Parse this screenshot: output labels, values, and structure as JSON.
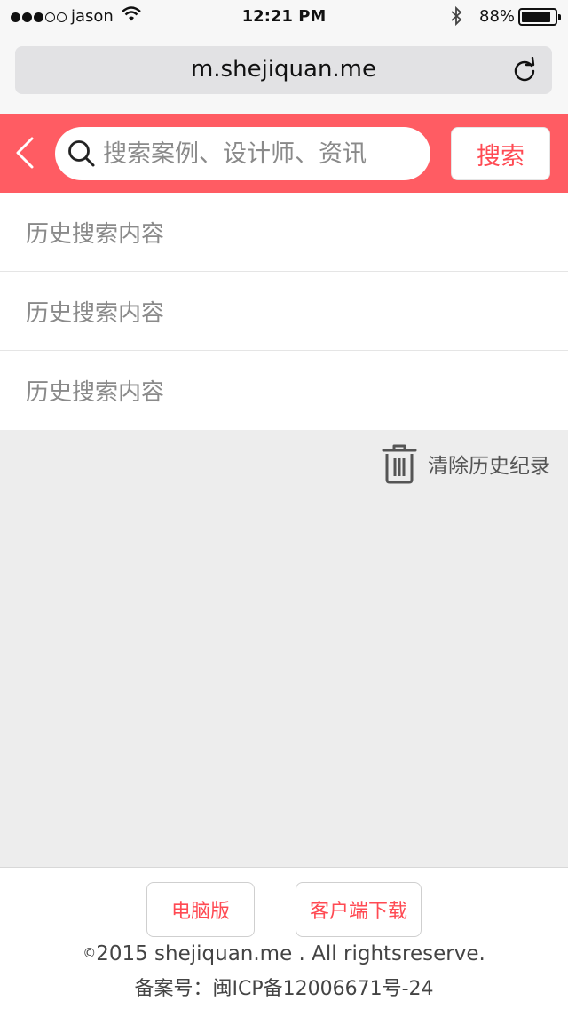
{
  "status_bar": {
    "carrier": "jason",
    "time": "12:21 PM",
    "battery_percent": "88%",
    "battery_level": 0.88,
    "signal_bars_filled": 3,
    "signal_bars_total": 5
  },
  "browser": {
    "url": "m.shejiquan.me"
  },
  "search": {
    "placeholder": "搜索案例、设计师、资讯",
    "button_label": "搜索"
  },
  "history": {
    "items": [
      {
        "label": "历史搜索内容"
      },
      {
        "label": "历史搜索内容"
      },
      {
        "label": "历史搜索内容"
      }
    ],
    "clear_label": "清除历史纪录"
  },
  "footer": {
    "desktop_label": "电脑版",
    "client_download_label": "客户端下载",
    "copyright_symbol": "©",
    "copyright_text": "2015 shejiquan.me . All rightsreserve.",
    "icp": "备案号：闽ICP备12006671号-24"
  },
  "colors": {
    "accent": "#ff5c63",
    "accent_text": "#ff4a53",
    "background": "#ededed"
  },
  "icons": [
    "wifi-icon",
    "bluetooth-icon",
    "battery-icon",
    "reload-icon",
    "back-icon",
    "search-icon",
    "trash-icon"
  ]
}
